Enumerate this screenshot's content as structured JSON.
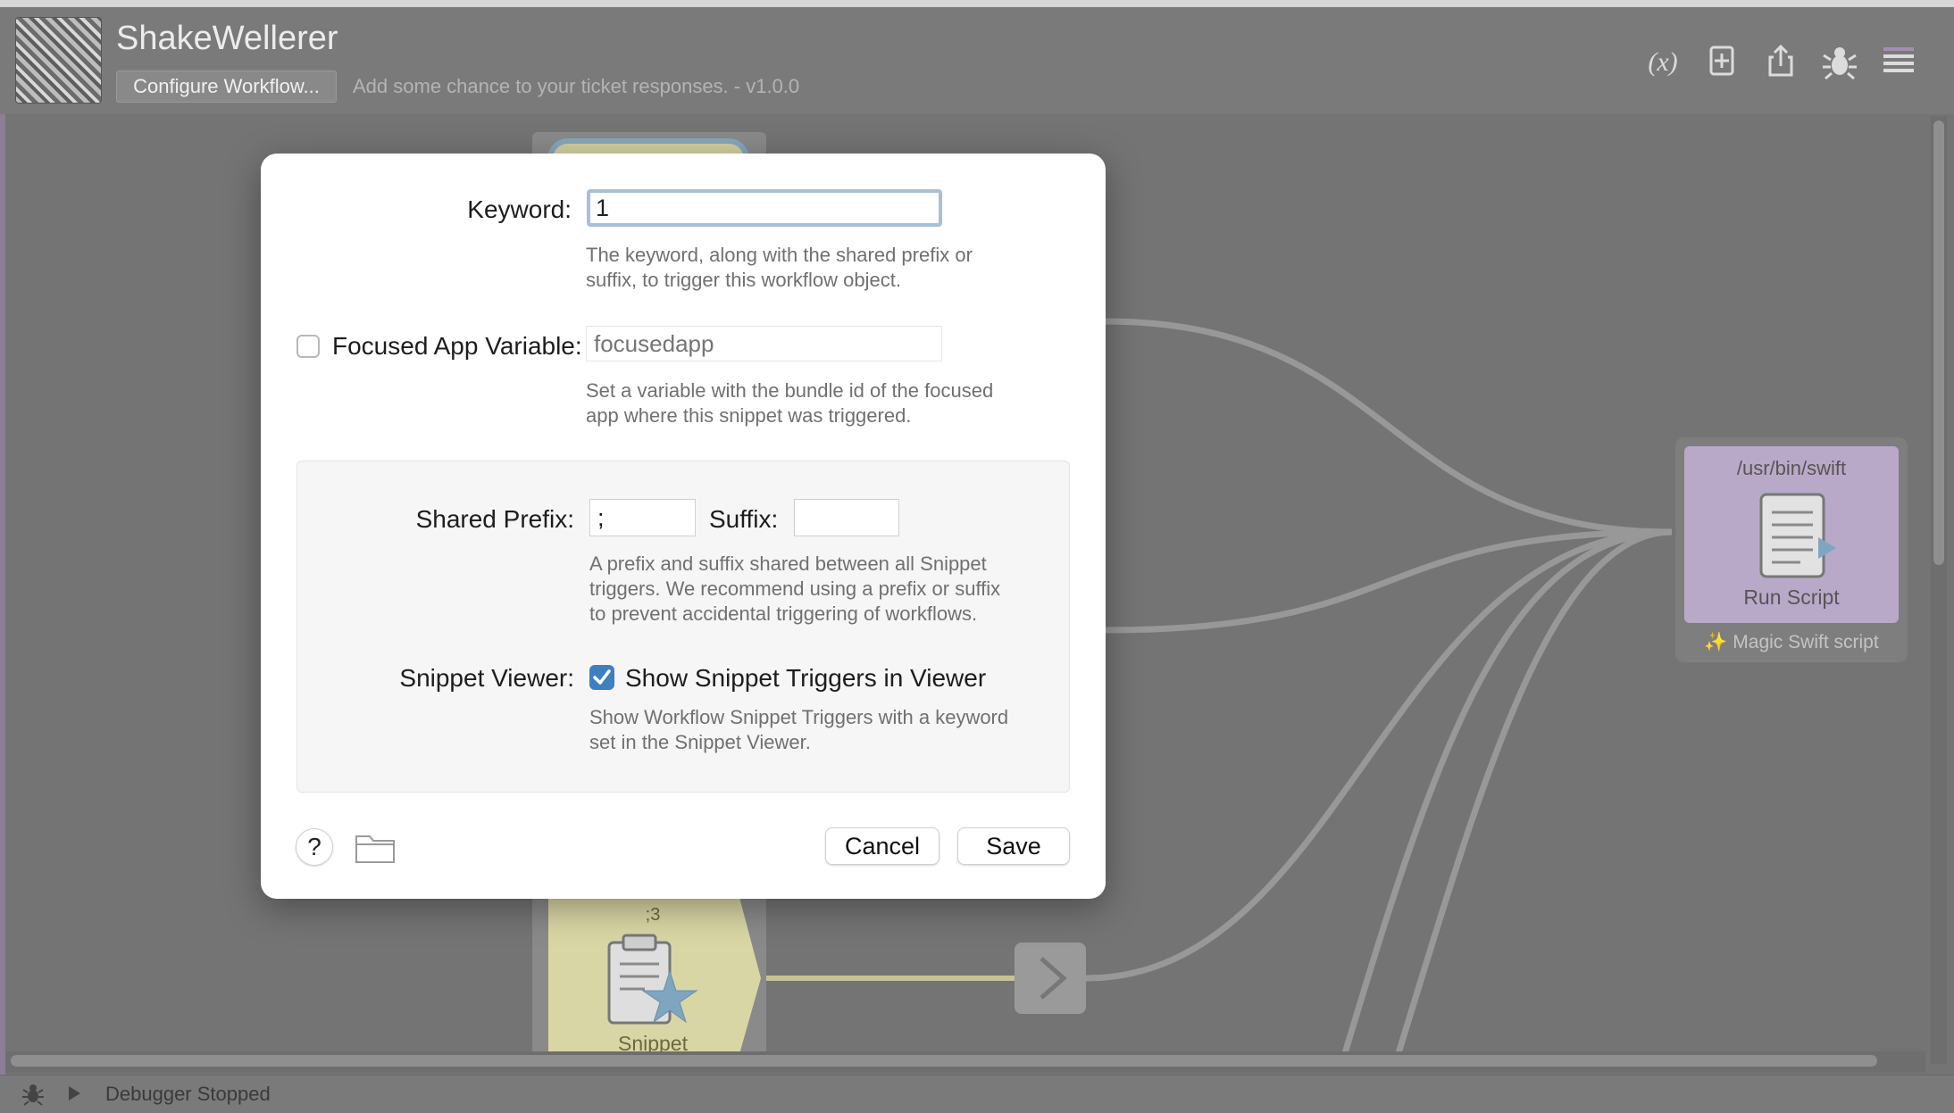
{
  "window": {
    "title": "ShakeWellerer",
    "configure_button": "Configure Workflow...",
    "subtitle": "Add some chance to your ticket responses. - v1.0.0",
    "toolbar_icons": [
      "variables-icon",
      "add-object-icon",
      "share-icon",
      "debug-icon",
      "menu-icon"
    ]
  },
  "canvas": {
    "script_node": {
      "path": "/usr/bin/swift",
      "label": "Run Script",
      "note": "✨ Magic Swift script",
      "color": "#b9a9c9"
    },
    "snippet_node": {
      "keyword": ";3",
      "label": "Snippet",
      "color": "#d9d6a5"
    }
  },
  "dialog": {
    "keyword_label": "Keyword:",
    "keyword_value": "1",
    "keyword_help": [
      "The keyword, along with the shared prefix or",
      "suffix, to trigger this workflow object."
    ],
    "focused_label": "Focused App Variable:",
    "focused_checked": false,
    "focused_placeholder": "focusedapp",
    "focused_help": [
      "Set a variable with the bundle id of the focused",
      "app where this snippet was triggered."
    ],
    "prefix_label": "Shared Prefix:",
    "prefix_value": ";",
    "suffix_label": "Suffix:",
    "suffix_value": "",
    "prefix_help": [
      "A prefix and suffix shared between all Snippet",
      "triggers. We recommend using a prefix or suffix",
      "to prevent accidental triggering of workflows."
    ],
    "viewer_label": "Snippet Viewer:",
    "viewer_checked": true,
    "viewer_option": "Show Snippet Triggers in Viewer",
    "viewer_help": [
      "Show Workflow Snippet Triggers with a keyword",
      "set in the Snippet Viewer."
    ],
    "help_button": "?",
    "cancel_button": "Cancel",
    "save_button": "Save",
    "accent": "#3f7fbf"
  },
  "status": {
    "text": "Debugger Stopped"
  }
}
